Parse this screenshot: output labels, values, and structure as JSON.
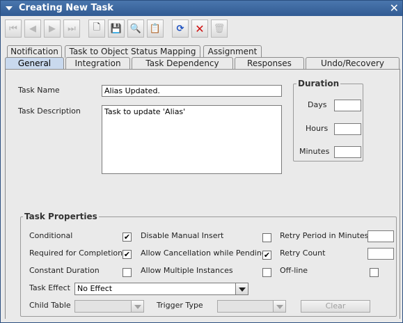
{
  "window": {
    "title": "Creating New Task"
  },
  "tabs_row1": [
    "Notification",
    "Task to Object Status Mapping",
    "Assignment"
  ],
  "tabs_row2": [
    "General",
    "Integration",
    "Task Dependency",
    "Responses",
    "Undo/Recovery"
  ],
  "general": {
    "task_name_label": "Task Name",
    "task_name_value": "Alias Updated.",
    "task_description_label": "Task Description",
    "task_description_value": "Task to update 'Alias'",
    "duration": {
      "title": "Duration",
      "days_label": "Days",
      "hours_label": "Hours",
      "minutes_label": "Minutes"
    }
  },
  "task_properties": {
    "title": "Task Properties",
    "conditional_label": "Conditional",
    "conditional_checked": true,
    "required_label": "Required for Completion",
    "required_checked": true,
    "constant_label": "Constant Duration",
    "constant_checked": false,
    "disable_manual_label": "Disable Manual Insert",
    "disable_manual_checked": false,
    "allow_cancel_label": "Allow Cancellation while Pending",
    "allow_cancel_checked": true,
    "allow_multiple_label": "Allow Multiple Instances",
    "allow_multiple_checked": false,
    "retry_period_label": "Retry Period in Minutes",
    "retry_count_label": "Retry Count",
    "offline_label": "Off-line",
    "offline_checked": false,
    "task_effect_label": "Task Effect",
    "task_effect_value": "No Effect",
    "child_table_label": "Child Table",
    "trigger_type_label": "Trigger Type",
    "clear_label": "Clear"
  }
}
